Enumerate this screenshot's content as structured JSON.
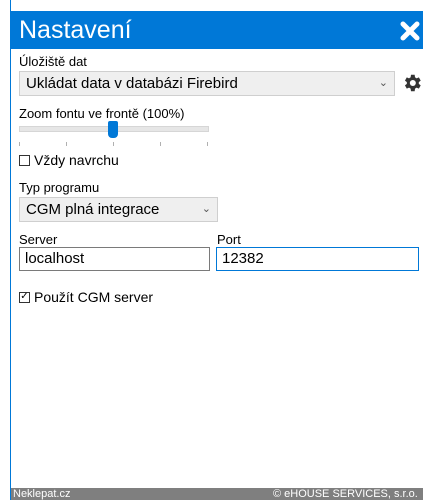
{
  "window": {
    "title": "Nastavení",
    "close_icon": "×",
    "accent": "#0078d7"
  },
  "storage": {
    "label": "Úložiště dat",
    "selected": "Ukládat data v databázi Firebird",
    "settings_icon": "gear-icon"
  },
  "zoom": {
    "label": "Zoom fontu ve frontě (100%)",
    "level_fraction": 0.5
  },
  "always_on_top": {
    "label": "Vždy navrchu",
    "checked": false
  },
  "program_type": {
    "label": "Typ programu",
    "selected": "CGM plná integrace"
  },
  "server": {
    "label": "Server",
    "value": "localhost"
  },
  "port": {
    "label": "Port",
    "value": "12382"
  },
  "use_cgm_server": {
    "label": "Použít CGM server",
    "checked": true
  },
  "statusbar": {
    "left": "Neklepat.cz",
    "right": "© eHOUSE SERVICES, s.r.o."
  }
}
